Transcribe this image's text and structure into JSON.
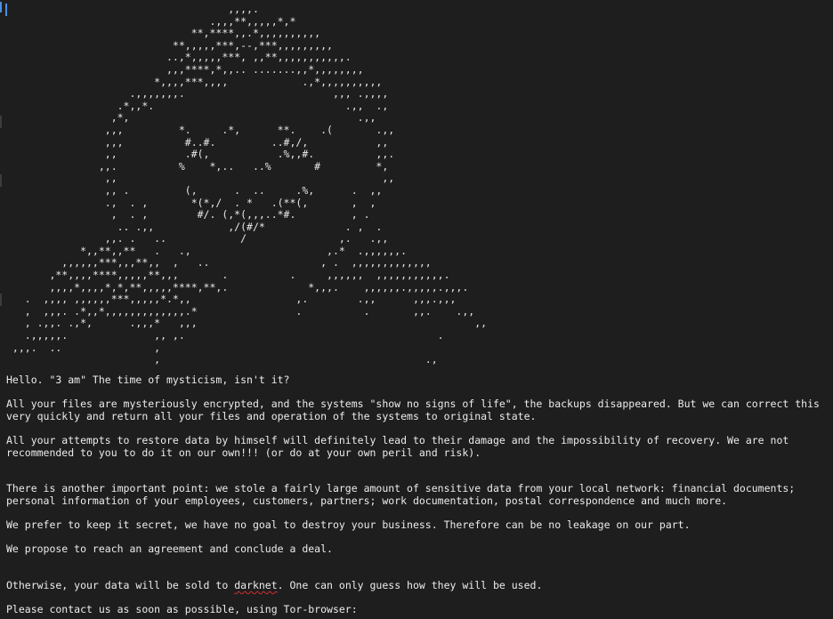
{
  "ascii_art": [
    "                                    ,,,,.",
    "                                 .,,,**,,,,,*,*",
    "                              **,****,,.*,,,,,,,,,,",
    "                           **,,,,,***,--,***,,,,,,,,,",
    "                          ..,*,,,,,***, ,,**,,,,,,,,,,,.",
    "                          ,,,****,*,,.. .......,,*,,,,,,,,",
    "                        *,,,,***,,,,            .,*,,,,,,,,,,",
    "                    .,,,,,,,.                        ,,, .,,,,",
    "                  .*,,*.                               .,,  .,",
    "                 ,*,                                     .,,",
    "                ,,,         *.     .*,      **.    .(       .,,",
    "                ,,,          #..#.         ..#,/,           ,,",
    "                ,,           .#(,           .%,,#.          ,,.",
    "               ,,.          %    *,..   ..%       #         *,",
    "                ,,                                           ,,",
    "                ,, .         (,      .  ..     .%,      .  ,,",
    "                .,  . ,       *(*,/  . *   .(**(,       ,  ,",
    "                 ,  . ,        #/. (,*(,,,..*#.         , .",
    "                  .. .,,            ,/(#/*             . ,  .",
    "                ,,. .   ..            /               ,.   .,,",
    "            *,,**,,**   .   .,                      ,.*  .,,,,,,.",
    "         ,,,,,,***,,,**,,  ,   ..                  , .  ,,,,,,,,,,,,,",
    "       ,**,,,,****,,,,,**,,,       .          .     ,,,,,,  ,,,,,,,,,,,.",
    "       ,,,,*,,,,*,*,**,,,,,****,**,.             *,,,.    ,,,,,,.,,,,,.,,,.",
    "   .  ,,,, ,,,,,,***,,,,,*.*,,                 ,.        .,,      ,,,.,,,",
    "   ,  ,,,. .*,,*,,,,,,,,,,,,,.*                .          .       ,,.    .,,",
    "   , .,,. .,*,      .,,,*   ,,,                                             ,,",
    "   .,,,,,.              ,, ,.                                         .",
    " ,,,.  ..               ,",
    "                        ,                                           .,"
  ],
  "note_lines": [
    "Hello. \"3 am\" The time of mysticism, isn't it?",
    "All your files are mysteriously encrypted, and the systems \"show no signs of life\", the backups disappeared. But we can correct this very quickly and return all your files and operation of the systems to original state.",
    "All your attempts to restore data by himself will definitely lead to their damage and the impossibility of recovery. We are not recommended to you to do it on our own!!! (or do at your own peril and risk).",
    "There is another important point: we stole a fairly large amount of sensitive data from your local network: financial documents; personal information of your employees, customers, partners; work documentation, postal correspondence and much more.",
    "We prefer to keep it secret, we have no goal to destroy your business. Therefore can be no leakage on our part.",
    "We propose to reach an agreement and conclude a deal."
  ],
  "darknet_line": {
    "before": "Otherwise, your data will be sold to ",
    "flagged_word": "darknet",
    "after": ". One can only guess how they will be used."
  },
  "contact_line": "Please contact us as soon as possible, using Tor-browser:",
  "colors": {
    "background": "#1e1e1e",
    "text": "#e6e6e6",
    "cursor": "#4a90e2",
    "spellcheck": "#d03030"
  }
}
